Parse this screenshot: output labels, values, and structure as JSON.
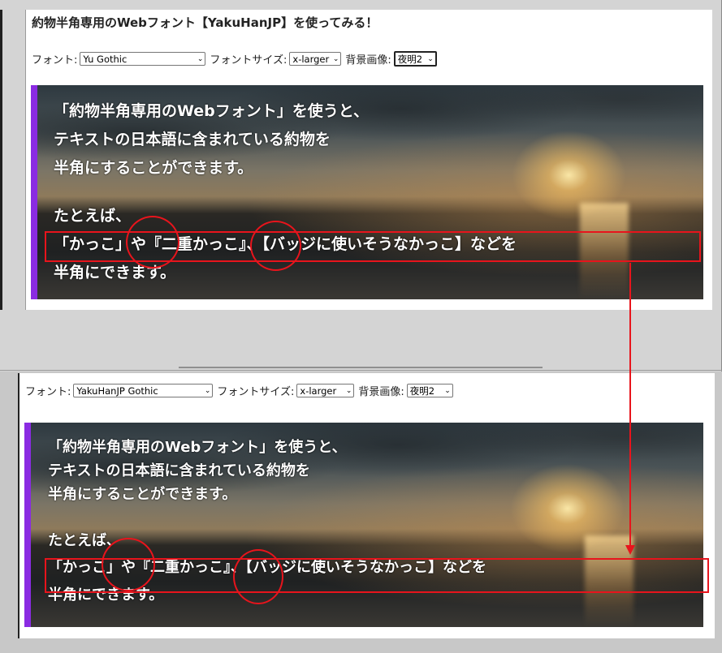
{
  "top": {
    "title": "約物半角専用のWebフォント【YakuHanJP】を使ってみる！",
    "font_label": "フォント:",
    "font_value": "Yu Gothic",
    "size_label": "フォントサイズ:",
    "size_value": "x-larger",
    "bg_label": "背景画像:",
    "bg_value": "夜明2"
  },
  "bottom": {
    "font_label": "フォント:",
    "font_value": "YakuHanJP Gothic",
    "size_label": "フォントサイズ:",
    "size_value": "x-larger",
    "bg_label": "背景画像:",
    "bg_value": "夜明2"
  },
  "hero_top": {
    "line1": "「約物半角専用のWebフォント」を使うと、",
    "line2": "テキストの日本語に含まれている約物を",
    "line3": "半角にすることができます。",
    "line4": "たとえば、",
    "line5": "「かっこ」や『二重かっこ』、【バッジに使いそうなかっこ】などを",
    "line6": "半角にできます。"
  },
  "hero_bottom": {
    "line1": "「約物半角専用のWebフォント」を使うと、",
    "line2": "テキストの日本語に含まれている約物を",
    "line3": "半角にすることができます。",
    "line4": "たとえば、",
    "line5": "「かっこ」や『二重かっこ』、【バッジに使いそうなかっこ】などを",
    "line6": "半角にできます。"
  },
  "colors": {
    "accent": "#8a2be2",
    "annotation": "#e8141c"
  },
  "icons": {
    "select_chevron": "chevron-down-icon"
  }
}
